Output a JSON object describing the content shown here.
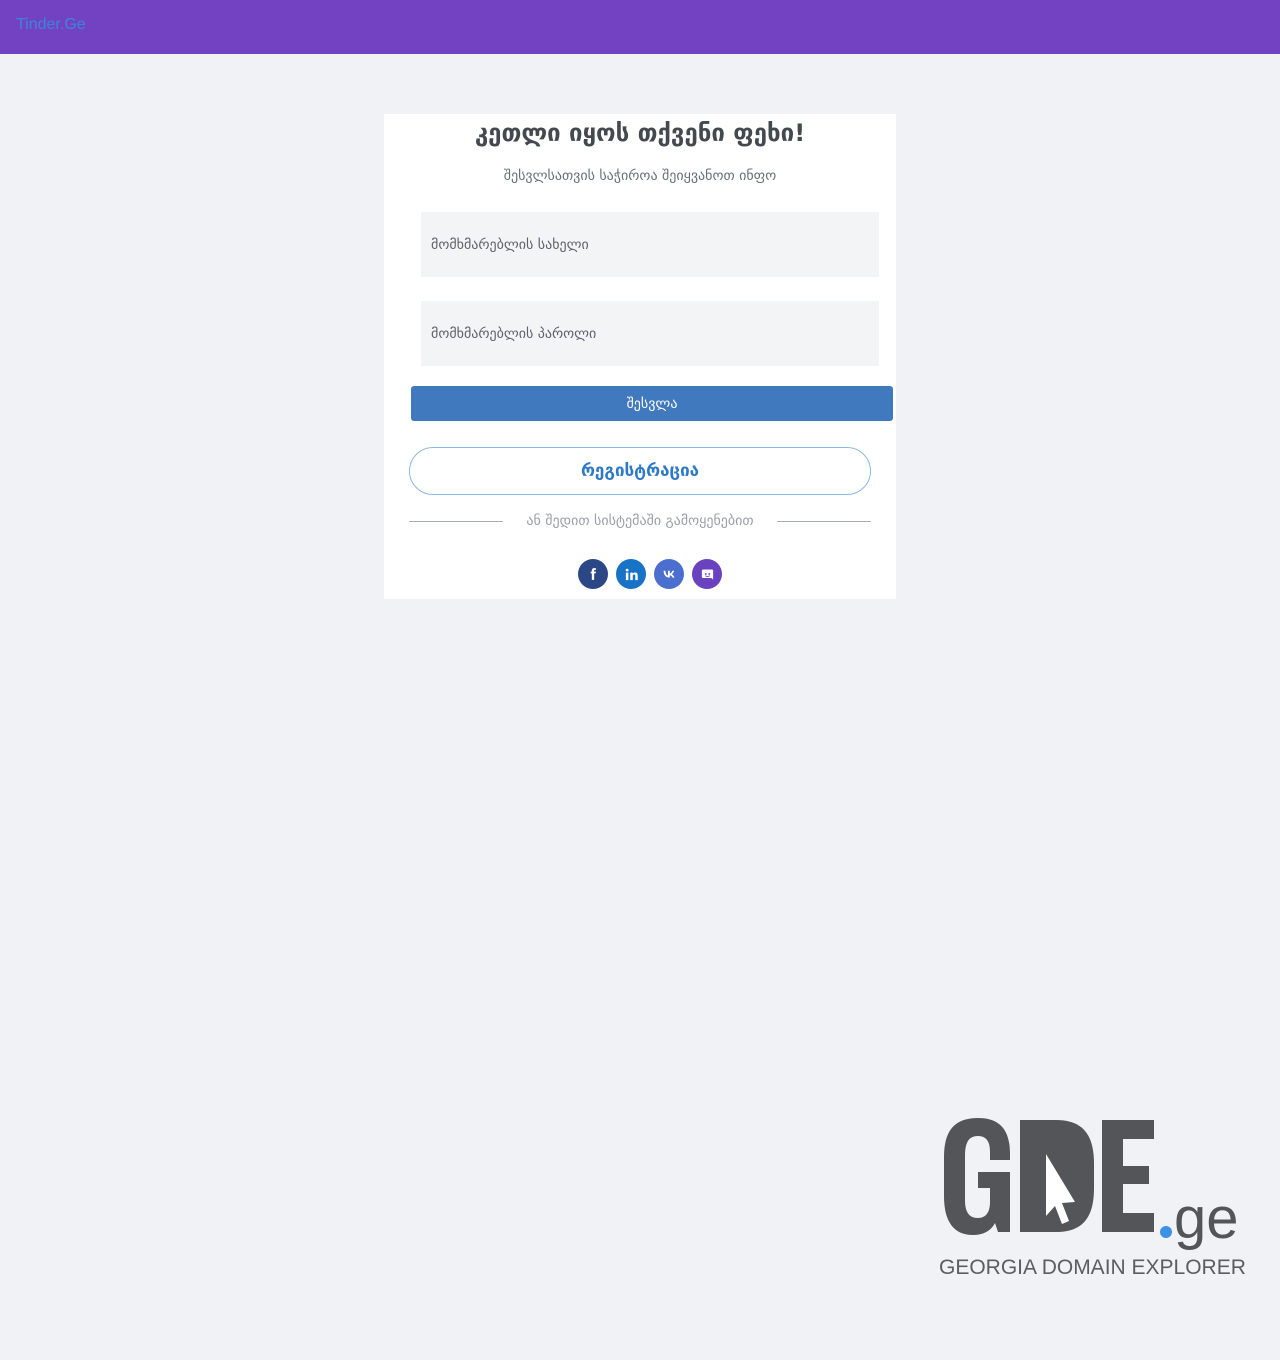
{
  "header": {
    "brand": "Tinder.Ge",
    "bg_color": "#7342c3",
    "brand_color": "#3a86d6"
  },
  "login": {
    "title": "კეთლი იყოს თქვენი ფეხი!",
    "subtitle": "შესვლსათვის საჭიროა შეიყვანოთ ინფო",
    "username_placeholder": "მომხმარებლის სახელი",
    "password_placeholder": "მომხმარებლის პაროლი",
    "login_button": "შესვლა",
    "register_button": "რეგისტრაცია",
    "divider_text": "ან შედით სისტემაში გამოყენებით",
    "login_button_color": "#4179bf",
    "register_text_color": "#2b79c7"
  },
  "social": [
    {
      "icon": "facebook-icon",
      "color": "#2c4786"
    },
    {
      "icon": "linkedin-icon",
      "color": "#1872c6"
    },
    {
      "icon": "vk-icon",
      "color": "#4b6fcf"
    },
    {
      "icon": "discord-icon",
      "color": "#6a42c0"
    }
  ],
  "watermark": {
    "logo_text": "GDE.ge",
    "caption": "GEORGIA DOMAIN EXPLORER"
  }
}
